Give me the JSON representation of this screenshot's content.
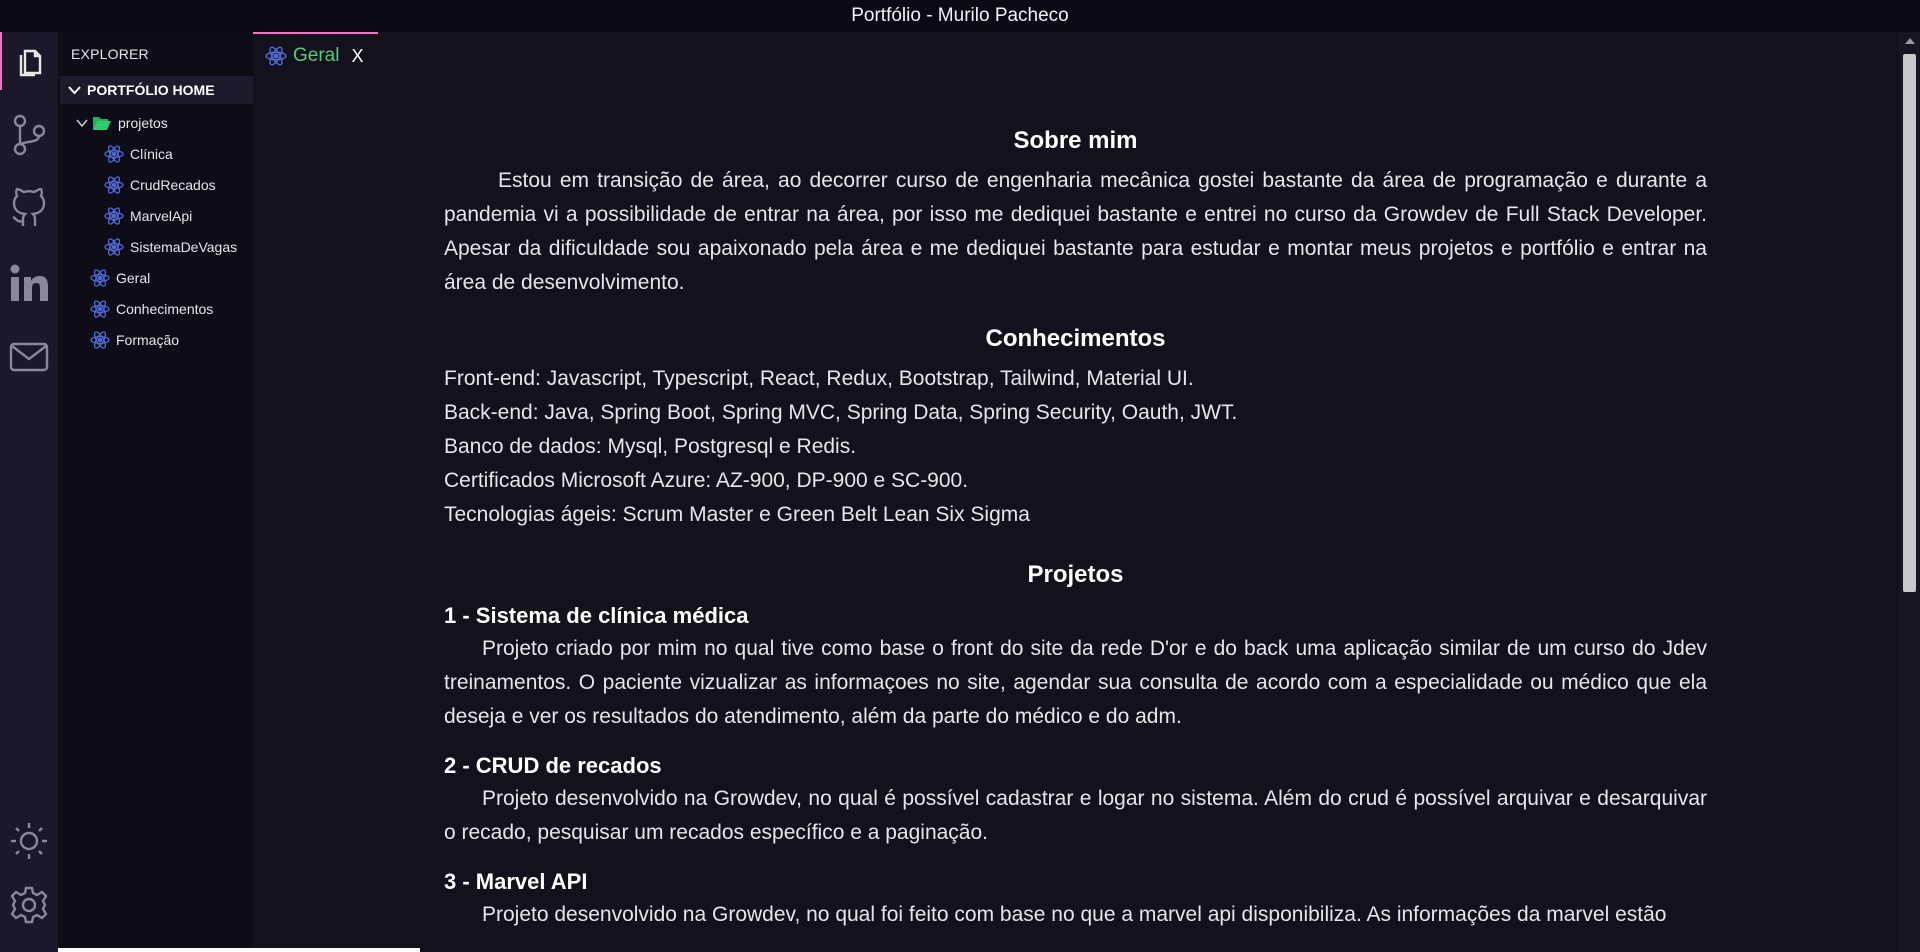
{
  "window": {
    "title": "Portfólio - Murilo Pacheco"
  },
  "activity_bar": {
    "items": [
      {
        "icon": "files-icon",
        "active": true
      },
      {
        "icon": "source-control-icon",
        "active": false
      },
      {
        "icon": "github-icon",
        "active": false
      },
      {
        "icon": "linkedin-icon",
        "active": false
      },
      {
        "icon": "mail-icon",
        "active": false
      }
    ],
    "bottom": [
      {
        "icon": "sun-icon"
      },
      {
        "icon": "gear-icon"
      }
    ]
  },
  "sidebar": {
    "explorer_label": "EXPLORER",
    "section_title": "PORTFÓLIO HOME",
    "folder": {
      "label": "projetos",
      "children": [
        "Clínica",
        "CrudRecados",
        "MarvelApi",
        "SistemaDeVagas"
      ]
    },
    "files": [
      "Geral",
      "Conhecimentos",
      "Formação"
    ]
  },
  "tab": {
    "label": "Geral",
    "close": "X"
  },
  "content": {
    "about": {
      "title": "Sobre mim",
      "text": "Estou em transição de área, ao decorrer curso de engenharia mecânica gostei bastante da área de programação e durante a pandemia vi a possibilidade de entrar na área, por isso me dediquei bastante e entrei no curso da Growdev de Full Stack Developer. Apesar da dificuldade sou apaixonado pela área e me dediquei bastante para estudar e montar meus projetos e portfólio e entrar na área de desenvolvimento."
    },
    "knowledge": {
      "title": "Conhecimentos",
      "lines": [
        "Front-end: Javascript, Typescript, React, Redux, Bootstrap, Tailwind, Material UI.",
        "Back-end: Java, Spring Boot, Spring MVC, Spring Data, Spring Security, Oauth, JWT.",
        "Banco de dados: Mysql, Postgresql e Redis.",
        "Certificados Microsoft Azure: AZ-900, DP-900 e SC-900.",
        "Tecnologias ágeis: Scrum Master e Green Belt Lean Six Sigma"
      ]
    },
    "projects": {
      "title": "Projetos",
      "items": [
        {
          "title": "1 - Sistema de clínica médica",
          "text": "Projeto criado por mim no qual tive como base o front do site da rede D'or e do back uma aplicação similar de um curso do Jdev treinamentos. O paciente vizualizar as informaçoes no site, agendar sua consulta de acordo com a especialidade ou médico que ela deseja e ver os resultados do atendimento, além da parte do médico e do adm."
        },
        {
          "title": "2 - CRUD de recados",
          "text": "Projeto desenvolvido na Growdev, no qual é possível cadastrar e logar no sistema. Além do crud é possível arquivar e desarquivar o recado, pesquisar um recados específico e a paginação."
        },
        {
          "title": "3 - Marvel API",
          "text": "Projeto desenvolvido na Growdev, no qual foi feito com base no que a marvel api disponibiliza. As informações da marvel estão"
        }
      ]
    }
  },
  "colors": {
    "accent": "#ff6ec7",
    "tab_label": "#49d27a",
    "react_icon": "#4f6bd8",
    "folder_icon": "#2ecc71"
  }
}
